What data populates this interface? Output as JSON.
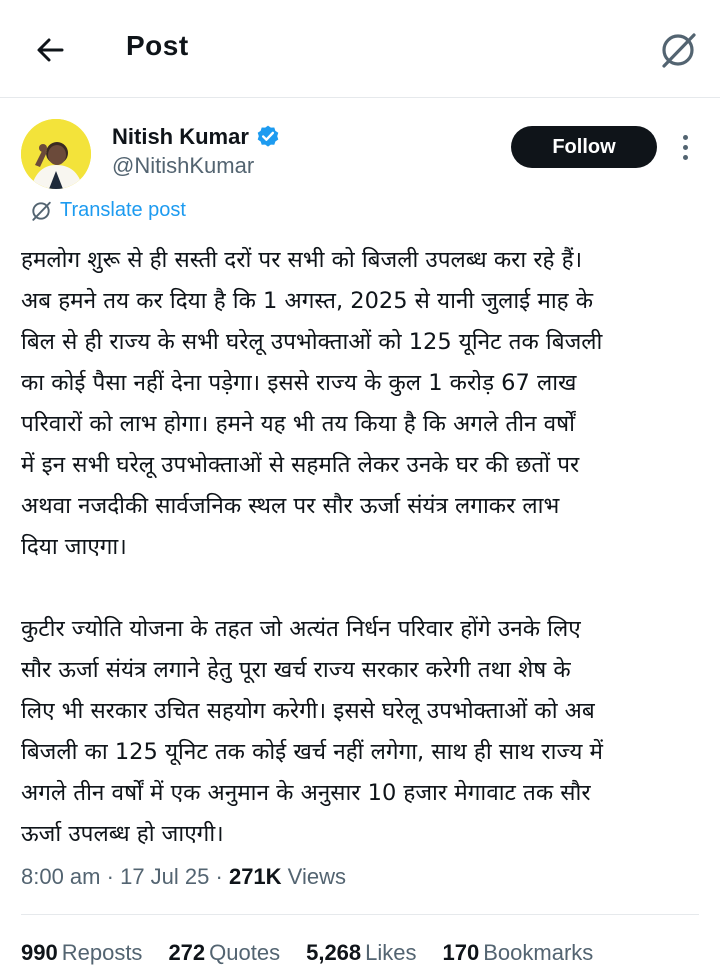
{
  "header": {
    "title": "Post",
    "back_icon": "arrow-left-icon",
    "grok_icon": "grok-icon"
  },
  "author": {
    "name": "Nitish Kumar",
    "handle": "@NitishKumar",
    "verified": true,
    "verified_color": "#1d9bf0",
    "avatar_bg": "#f3e33a"
  },
  "actions": {
    "follow_label": "Follow",
    "translate_label": "Translate post"
  },
  "post": {
    "paragraph1": [
      "हमलोग शुरू से ही सस्ती दरों पर सभी को बिजली उपलब्ध करा रहे हैं।",
      "अब हमने तय कर दिया है कि 1 अगस्त, 2025 से यानी जुलाई माह के",
      "बिल से ही राज्य के सभी घरेलू उपभोक्ताओं को 125 यूनिट तक बिजली",
      "का कोई पैसा नहीं देना पड़ेगा। इससे राज्य के कुल 1 करोड़ 67 लाख",
      "परिवारों को लाभ होगा। हमने यह भी तय किया है कि अगले तीन वर्षों",
      "में इन सभी घरेलू उपभोक्ताओं से सहमति लेकर उनके घर की छतों पर",
      "अथवा नजदीकी सार्वजनिक स्थल पर सौर ऊर्जा संयंत्र लगाकर लाभ",
      "दिया जाएगा।"
    ],
    "paragraph2": [
      "कुटीर ज्योति योजना के तहत जो अत्यंत निर्धन परिवार होंगे उनके लिए",
      "सौर ऊर्जा संयंत्र लगाने हेतु पूरा खर्च राज्य सरकार करेगी तथा शेष के",
      "लिए भी सरकार उचित सहयोग करेगी। इससे घरेलू उपभोक्ताओं को अब",
      "बिजली का 125 यूनिट तक कोई खर्च नहीं लगेगा, साथ ही साथ राज्य में",
      "अगले तीन वर्षों में एक अनुमान के अनुसार 10 हजार मेगावाट तक सौर",
      "ऊर्जा उपलब्ध हो जाएगी।"
    ]
  },
  "meta": {
    "time": "8:00 am",
    "date": "17 Jul 25",
    "views_count": "271K",
    "views_label": "Views",
    "separator": "·"
  },
  "stats": {
    "reposts_count": "990",
    "reposts_label": "Reposts",
    "quotes_count": "272",
    "quotes_label": "Quotes",
    "likes_count": "5,268",
    "likes_label": "Likes",
    "bookmarks_count": "170",
    "bookmarks_label": "Bookmarks"
  }
}
